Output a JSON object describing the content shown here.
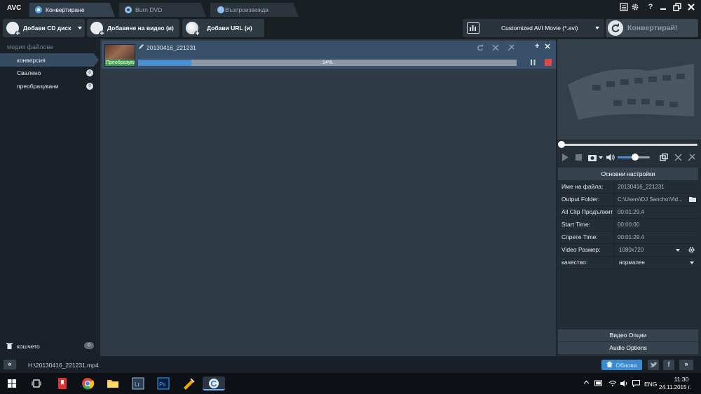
{
  "app": {
    "logo": "AVC"
  },
  "tabs": [
    {
      "label": "Конвертиране",
      "active": true
    },
    {
      "label": "Burn DVD",
      "active": false
    },
    {
      "label": "Възпроизвежда",
      "active": false
    }
  ],
  "window_controls": {
    "help": "?"
  },
  "toolbar": {
    "add_cd": "Добави CD диск",
    "add_video": "Добавяне на видео (и)",
    "add_url": "Добави URL (и)",
    "format": "Customized AVI Movie (*.avi)",
    "convert": "Конвертирай!"
  },
  "sidebar": {
    "header": "медия файлове",
    "items": [
      {
        "label": "конверсия",
        "active": true,
        "badge": ""
      },
      {
        "label": "Свалено",
        "active": false,
        "badge": "0"
      },
      {
        "label": "преобразувани",
        "active": false,
        "badge": "0"
      }
    ],
    "trash_label": "кошчето",
    "trash_count": "0"
  },
  "file": {
    "name": "20130416_221231",
    "thumb_label": "Преобразува...",
    "progress_text": "14%",
    "progress": 0.14
  },
  "settings": {
    "header": "Основни настройки",
    "rows": [
      {
        "key": "Име на файла:",
        "value": "20130416_221231"
      },
      {
        "key": "Output Folder:",
        "value": "C:\\Users\\DJ Sancho\\Vid..."
      },
      {
        "key": "All Clip Продължит",
        "value": "00:01:29.4"
      },
      {
        "key": "Start Time:",
        "value": "00:00:00"
      },
      {
        "key": "Спрете Time:",
        "value": "00:01:29.4"
      },
      {
        "key": "Video Размер:",
        "value": "1080x720"
      },
      {
        "key": "качество:",
        "value": "нормален"
      }
    ],
    "video_options": "Видео Опции",
    "audio_options": "Audio Options"
  },
  "status": {
    "path": "H:\\20130416_221231.mp4",
    "update": "Обнови",
    "collapse": "«",
    "expand": "»"
  },
  "taskbar": {
    "lang": "ENG",
    "time": "11:30",
    "date": "24.11.2015 г."
  },
  "colors": {
    "accent": "#3b8bd1",
    "progress": "#4a90d0",
    "stop": "#e04848"
  }
}
